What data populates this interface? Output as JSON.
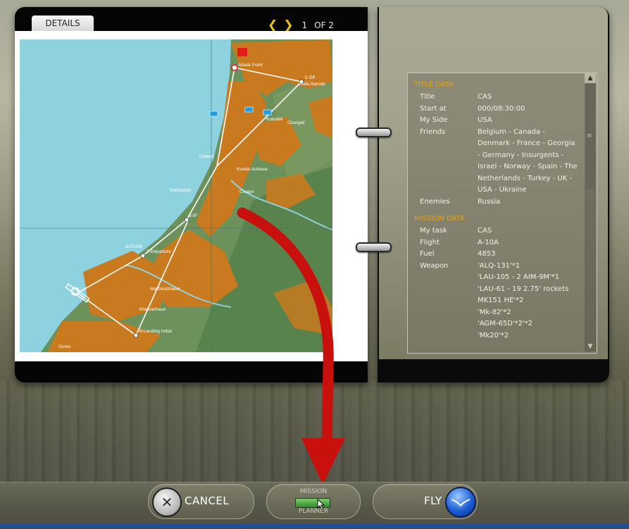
{
  "details_tab": "DETAILS",
  "pager": {
    "current": "1",
    "of": "OF 2"
  },
  "map": {
    "labels": {
      "attack_point": "Attack Point",
      "off": "5 Off",
      "zeda": "Zeda-Sameb",
      "kvedo": "Kveda-Achieva",
      "batumi": "BATUMI",
      "departure": "2-Departure",
      "landing": "6-Landing Initial",
      "sp": "3-IP",
      "chakvi": "Chakvi",
      "kobuleti": "Kobuleti",
      "ozurgeti": "Ozurgeti",
      "makhindzhauri": "Makhindzhauri",
      "gonio": "Gonio",
      "tsikhisdziri": "Tsikhisdziri",
      "khelvachauri": "Khelvachauri",
      "chaqvi": "Chaqvi"
    }
  },
  "title_data": {
    "header": "TITLE DATA",
    "rows": [
      {
        "key": "Title",
        "value": [
          "CAS"
        ]
      },
      {
        "key": "Start at",
        "value": [
          "000/08:30:00"
        ]
      },
      {
        "key": "My Side",
        "value": [
          "USA"
        ]
      },
      {
        "key": "Friends",
        "value": [
          "Belgium - Canada -",
          "Denmark - France - Georgia",
          "- Germany - Insurgents -",
          "Israel - Norway - Spain - The",
          "Netherlands - Turkey - UK -",
          "USA - Ukraine"
        ]
      },
      {
        "key": "Enemies",
        "value": [
          "Russia"
        ]
      }
    ]
  },
  "mission_data": {
    "header": "MISSION DATA",
    "rows": [
      {
        "key": "My task",
        "value": [
          "CAS"
        ]
      },
      {
        "key": "Flight",
        "value": [
          "A-10A"
        ]
      },
      {
        "key": "Fuel",
        "value": [
          "4853"
        ]
      },
      {
        "key": "Weapon",
        "value": [
          "'ALQ-131'*1",
          "'LAU-105 - 2 AIM-9M'*1",
          "'LAU-61 - 19 2.75' rockets",
          "MK151 HE'*2",
          "'Mk-82'*2",
          "'AGM-65D'*2'*2",
          "'Mk20'*2"
        ]
      }
    ]
  },
  "buttons": {
    "cancel": "CANCEL",
    "mission_top": "MISSION",
    "mission_bottom": "PLANNER",
    "fly": "FLY"
  },
  "colors": {
    "section_header": "#e0a21c",
    "sea": "#8fd2df",
    "land_urban": "#c97a1e",
    "land_green": "#5f8a4a",
    "arrow": "#c8100d",
    "pager_arrow": "#e8c21a"
  }
}
